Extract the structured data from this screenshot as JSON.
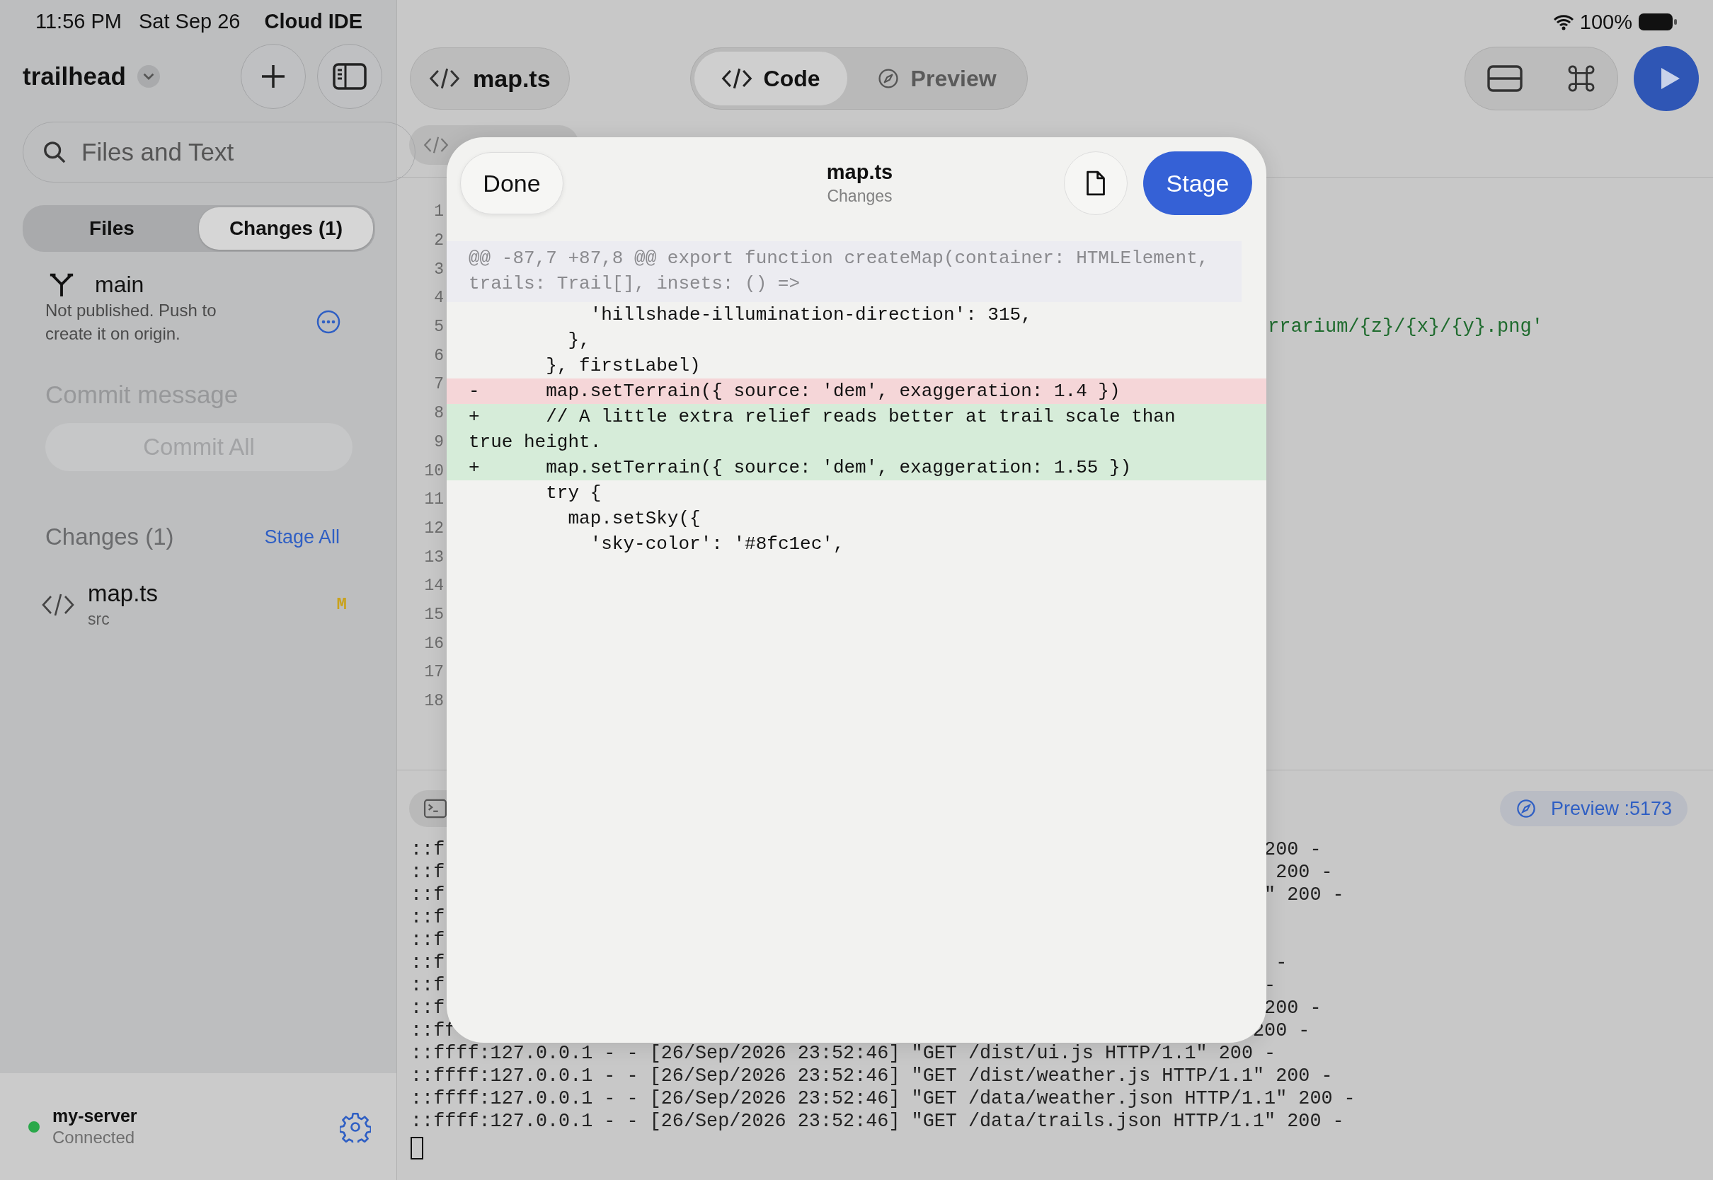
{
  "status_bar": {
    "time": "11:56 PM",
    "date": "Sat Sep 26",
    "app": "Cloud IDE",
    "battery": "100%"
  },
  "sidebar": {
    "project": "trailhead",
    "search": {
      "placeholder": "Files and Text"
    },
    "tabs": [
      {
        "label": "Files",
        "selected": false
      },
      {
        "label": "Changes (1)",
        "selected": true
      }
    ],
    "branch": {
      "name": "main",
      "note": "Not published. Push to create it on origin."
    },
    "commit": {
      "placeholder": "Commit message",
      "button": "Commit All",
      "disabled": true
    },
    "changes": {
      "title": "Changes (1)",
      "action": "Stage All",
      "files": [
        {
          "name": "map.ts",
          "folder": "src",
          "status": "M"
        }
      ]
    },
    "server": {
      "name": "my-server",
      "status": "Connected",
      "connected": true
    }
  },
  "toolbar": {
    "file": "map.ts",
    "modes": [
      {
        "label": "Code",
        "selected": true,
        "kind": "code"
      },
      {
        "label": "Preview",
        "selected": false,
        "kind": "preview"
      }
    ]
  },
  "editor": {
    "lines": [
      {
        "number": "1"
      },
      {
        "number": "2"
      },
      {
        "number": "3"
      },
      {
        "number": "4"
      },
      {
        "number": "5",
        "code": "rrarium/{z}/{x}/{y}.png'"
      },
      {
        "number": "6"
      },
      {
        "number": "7"
      },
      {
        "number": "8"
      },
      {
        "number": "9"
      },
      {
        "number": "10"
      },
      {
        "number": "11"
      },
      {
        "number": "12"
      },
      {
        "number": "13"
      },
      {
        "number": "14"
      },
      {
        "number": "15"
      },
      {
        "number": "16"
      },
      {
        "number": "17"
      },
      {
        "number": "18"
      }
    ]
  },
  "terminal": {
    "preview": "Preview :5173",
    "lines": [
      {
        "left": "::f",
        "right": "200 -"
      },
      {
        "left": "::f",
        "right": "200 -"
      },
      {
        "left": "::f",
        "right": "\" 200 -"
      },
      {
        "left": "::f"
      },
      {
        "left": "::f"
      },
      {
        "left": "::f",
        "right": "-"
      },
      {
        "left": "::f",
        "right": "-"
      },
      {
        "left": "::f",
        "right": "200 -"
      },
      {
        "left": "::ff",
        "right": "200 -"
      },
      {
        "left": "::ffff:127.0.0.1 - - [26/Sep/2026 23:52:46] \"GET /dist/ui.js HTTP/1.1\" 200 -"
      },
      {
        "left": "::ffff:127.0.0.1 - - [26/Sep/2026 23:52:46] \"GET /dist/weather.js HTTP/1.1\" 200 -"
      },
      {
        "left": "::ffff:127.0.0.1 - - [26/Sep/2026 23:52:46] \"GET /data/weather.json HTTP/1.1\" 200 -"
      },
      {
        "left": "::ffff:127.0.0.1 - - [26/Sep/2026 23:52:46] \"GET /data/trails.json HTTP/1.1\" 200 -"
      }
    ]
  },
  "diff_sheet": {
    "done": "Done",
    "title": "map.ts",
    "subtitle": "Changes",
    "stage": "Stage",
    "hunk": "@@ -87,7 +87,8 @@ export function createMap(container: HTMLElement, trails: Trail[], insets: () =>",
    "lines": [
      {
        "kind": "context",
        "text": "           'hillshade-illumination-direction': 315,"
      },
      {
        "kind": "context",
        "text": "         },"
      },
      {
        "kind": "context",
        "text": "       }, firstLabel)"
      },
      {
        "kind": "removed",
        "text": "-      map.setTerrain({ source: 'dem', exaggeration: 1.4 })"
      },
      {
        "kind": "added",
        "text": "+      // A little extra relief reads better at trail scale than true height."
      },
      {
        "kind": "added",
        "text": "+      map.setTerrain({ source: 'dem', exaggeration: 1.55 })"
      },
      {
        "kind": "context",
        "text": "       try {"
      },
      {
        "kind": "context",
        "text": "         map.setSky({"
      },
      {
        "kind": "context",
        "text": "           'sky-color': '#8fc1ec',"
      }
    ]
  }
}
